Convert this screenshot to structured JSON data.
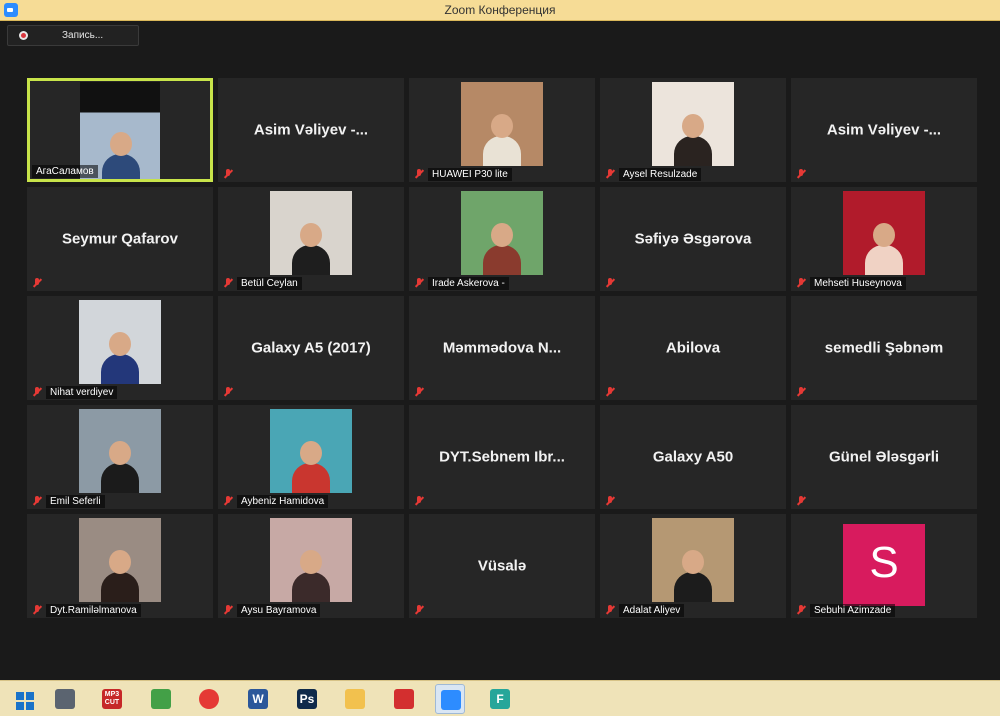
{
  "window": {
    "title": "Zoom Конференция"
  },
  "recording": {
    "label": "Запись..."
  },
  "participants": [
    {
      "name": "АгаСаламов",
      "display": "",
      "video": true,
      "active": true,
      "muted": false,
      "photo_bg": "#a7b9cc",
      "photo_fg": "#2d4a7a"
    },
    {
      "name": "",
      "display": "Asim  Vəliyev  -...",
      "video": false,
      "muted": true
    },
    {
      "name": "HUAWEI P30 lite",
      "display": "",
      "video": true,
      "muted": true,
      "photo_bg": "#b68966",
      "photo_fg": "#e9e2d5"
    },
    {
      "name": "Aysel Resulzade",
      "display": "",
      "video": true,
      "muted": true,
      "photo_bg": "#ece4dc",
      "photo_fg": "#2a2320"
    },
    {
      "name": "",
      "display": "Asim  Vəliyev  -...",
      "video": false,
      "muted": true
    },
    {
      "name": "",
      "display": "Seymur Qafarov",
      "video": false,
      "muted": true
    },
    {
      "name": "Betül Ceylan",
      "display": "",
      "video": true,
      "muted": true,
      "photo_bg": "#d9d4cd",
      "photo_fg": "#1e1e1e"
    },
    {
      "name": "Irade Askerova -",
      "display": "",
      "video": true,
      "muted": true,
      "photo_bg": "#6fa56a",
      "photo_fg": "#8a3b2e"
    },
    {
      "name": "",
      "display": "Səfiyə Əsgərova",
      "video": false,
      "muted": true
    },
    {
      "name": "Mehseti Huseynova",
      "display": "",
      "video": true,
      "muted": true,
      "photo_bg": "#b11b2b",
      "photo_fg": "#f0d2c4"
    },
    {
      "name": "Nihat verdiyev",
      "display": "",
      "video": true,
      "muted": true,
      "photo_bg": "#d2d6da",
      "photo_fg": "#23377a"
    },
    {
      "name": "",
      "display": "Galaxy A5 (2017)",
      "video": false,
      "muted": true
    },
    {
      "name": "",
      "display": "Məmmədova  N...",
      "video": false,
      "muted": true
    },
    {
      "name": "",
      "display": "Abilova",
      "video": false,
      "muted": true
    },
    {
      "name": "",
      "display": "semedli Şəbnəm",
      "video": false,
      "muted": true
    },
    {
      "name": "Emil Seferli",
      "display": "",
      "video": true,
      "muted": true,
      "photo_bg": "#8c9aa5",
      "photo_fg": "#1b1b1b"
    },
    {
      "name": "Aybeniz Hamidova",
      "display": "",
      "video": true,
      "muted": true,
      "photo_bg": "#4aa6b5",
      "photo_fg": "#c9362f"
    },
    {
      "name": "",
      "display": "DYT.Sebnem  Ibr...",
      "video": false,
      "muted": true
    },
    {
      "name": "",
      "display": "Galaxy A50",
      "video": false,
      "muted": true
    },
    {
      "name": "",
      "display": "Günel Ələsgərli",
      "video": false,
      "muted": true
    },
    {
      "name": "Dyt.Ramiləlmanova",
      "display": "",
      "video": true,
      "muted": true,
      "photo_bg": "#9a8c83",
      "photo_fg": "#2a1e1a"
    },
    {
      "name": "Aysu Bayramova",
      "display": "",
      "video": true,
      "muted": true,
      "photo_bg": "#c7a9a5",
      "photo_fg": "#3b2a2a"
    },
    {
      "name": "",
      "display": "Vüsalə",
      "video": false,
      "muted": true
    },
    {
      "name": "Adalat Aliyev",
      "display": "",
      "video": true,
      "muted": true,
      "photo_bg": "#b59873",
      "photo_fg": "#1c1c1c"
    },
    {
      "name": "Sebuhi Azimzade",
      "display": "",
      "video": false,
      "avatar_letter": "S",
      "muted": true
    }
  ],
  "taskbar": {
    "icons": [
      {
        "name": "start-icon",
        "color": "#1a73c9"
      },
      {
        "name": "media-player-icon",
        "color": "#5b6470"
      },
      {
        "name": "mp3-cut-icon",
        "color": "#c62828",
        "text": "MP3 CUT"
      },
      {
        "name": "plant-app-icon",
        "color": "#43a047"
      },
      {
        "name": "chrome-icon",
        "color": "#e53935"
      },
      {
        "name": "word-icon",
        "color": "#2b579a",
        "text": "W"
      },
      {
        "name": "photoshop-icon",
        "color": "#0f2a4a",
        "text": "Ps"
      },
      {
        "name": "file-explorer-icon",
        "color": "#f2c14e"
      },
      {
        "name": "acrobat-icon",
        "color": "#d32f2f"
      },
      {
        "name": "zoom-icon",
        "color": "#2d8cff"
      },
      {
        "name": "fastone-icon",
        "color": "#26a69a",
        "text": "F"
      }
    ]
  }
}
